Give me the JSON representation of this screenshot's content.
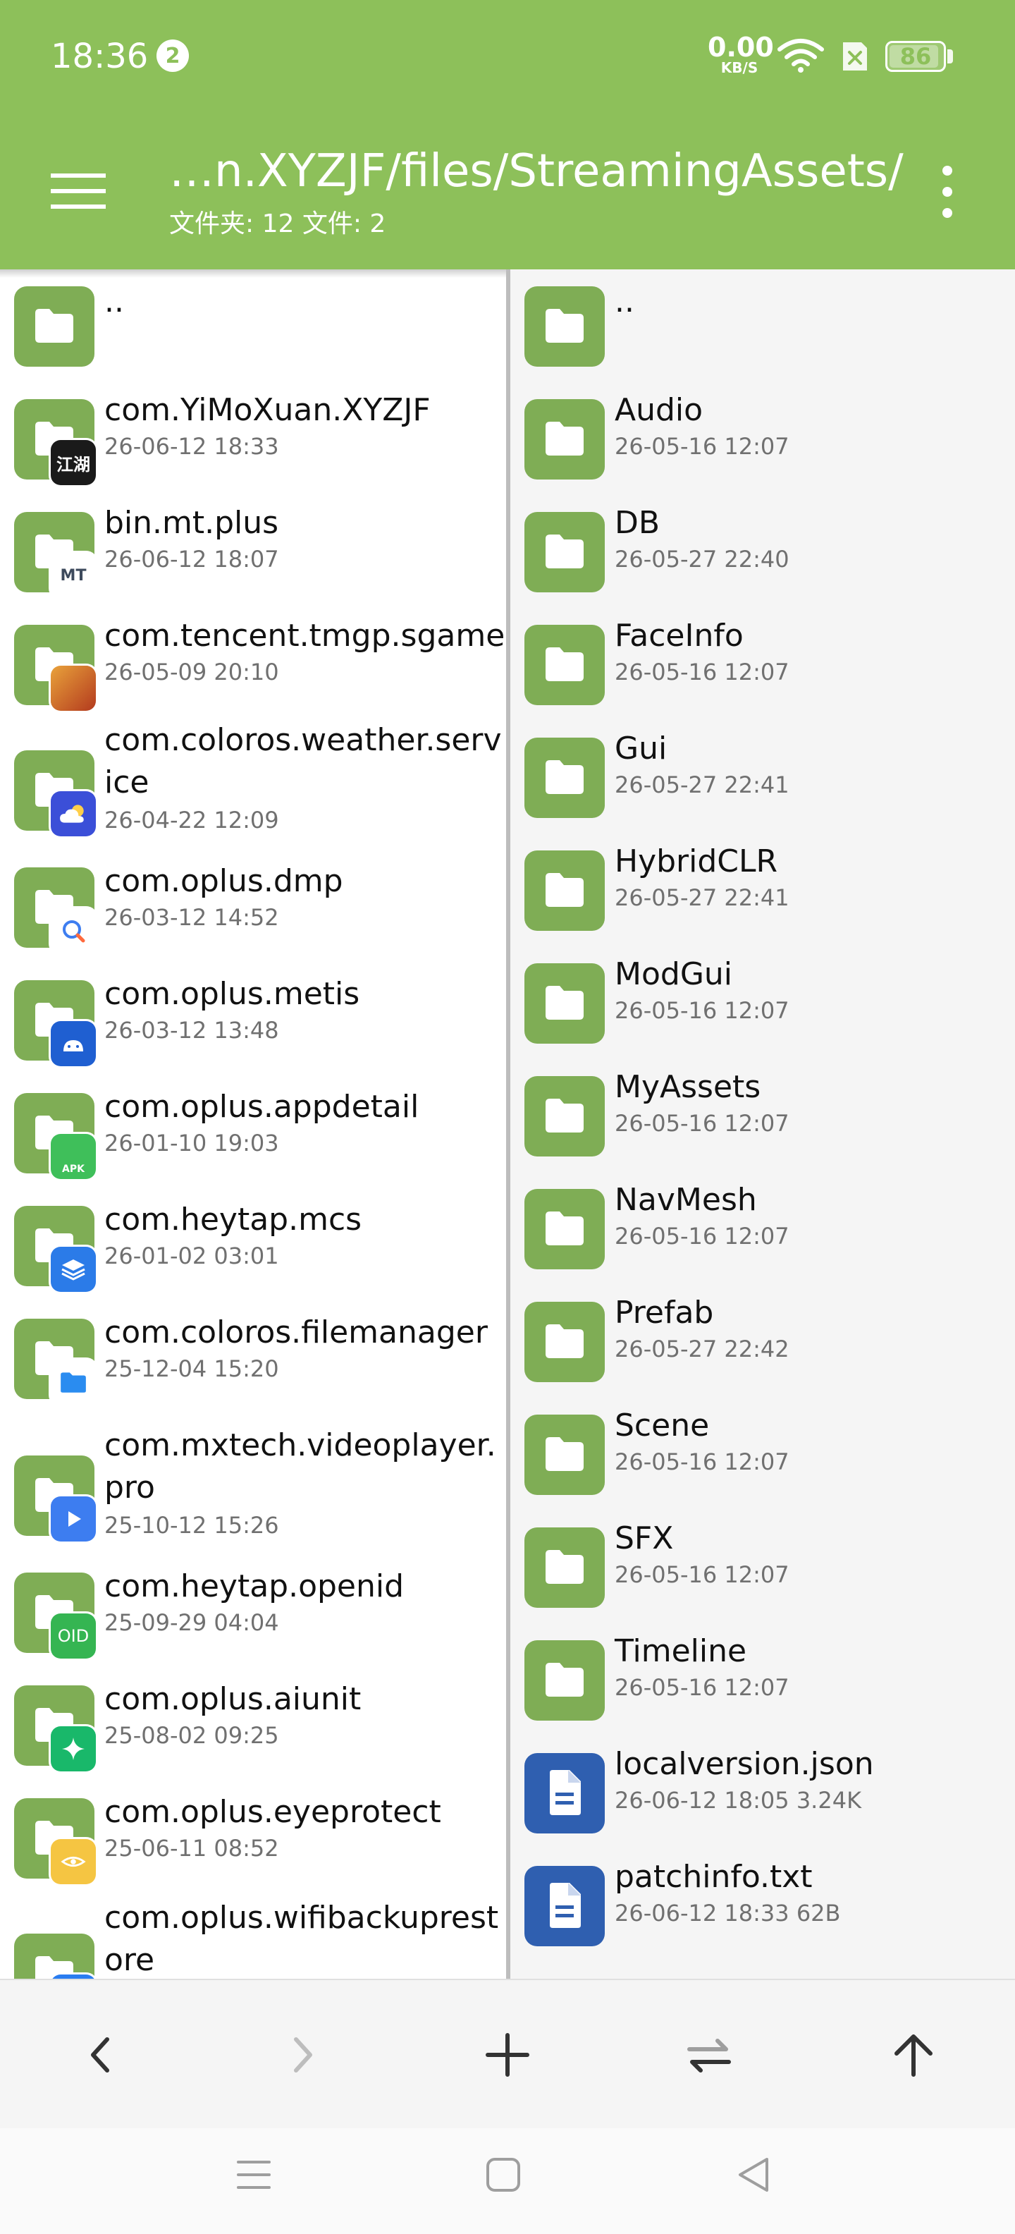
{
  "status_bar": {
    "time": "18:36",
    "notification_count": "2",
    "net_speed_value": "0.00",
    "net_speed_unit": "KB/S",
    "battery": "86",
    "battery_level_pct": 86
  },
  "header": {
    "path_title": "…n.XYZJF/files/StreamingAssets/",
    "folder_count": "文件夹: 12 文件: 2"
  },
  "left_panel": {
    "items": [
      {
        "name": "..",
        "date": ""
      },
      {
        "name": "com.YiMoXuan.XYZJF",
        "date": "26-06-12 18:33",
        "badge_text": "江湖",
        "badge_color": "#1a1a1a"
      },
      {
        "name": "bin.mt.plus",
        "date": "26-06-12 18:07",
        "badge_text": "MT",
        "badge_color": "#3d4a5c"
      },
      {
        "name": "com.tencent.tmgp.sgame",
        "date": "26-05-09 20:10",
        "badge_text": "",
        "badge_color": "#c4452a"
      },
      {
        "name": "com.coloros.weather.serv",
        "name2": "ice",
        "date": "26-04-22 12:09",
        "badge_text": "",
        "badge_color": "#3b4fd8"
      },
      {
        "name": "com.oplus.dmp",
        "date": "26-03-12 14:52",
        "badge_text": "",
        "badge_color": "#ffffff"
      },
      {
        "name": "com.oplus.metis",
        "date": "26-03-12 13:48",
        "badge_text": "",
        "badge_color": "#1f5fd1"
      },
      {
        "name": "com.oplus.appdetail",
        "date": "26-01-10 19:03",
        "badge_text": "APK",
        "badge_color": "#3fbf5a"
      },
      {
        "name": "com.heytap.mcs",
        "date": "26-01-02 03:01",
        "badge_text": "",
        "badge_color": "#2b7be8"
      },
      {
        "name": "com.coloros.filemanager",
        "date": "25-12-04 15:20",
        "badge_text": "",
        "badge_color": "#ffffff"
      },
      {
        "name": "com.mxtech.videoplayer.",
        "name2": "pro",
        "date": "25-10-12 15:26",
        "badge_text": "",
        "badge_color": "#3d7df0"
      },
      {
        "name": "com.heytap.openid",
        "date": "25-09-29 04:04",
        "badge_text": "OID",
        "badge_color": "#35b552"
      },
      {
        "name": "com.oplus.aiunit",
        "date": "25-08-02 09:25",
        "badge_text": "",
        "badge_color": "#19b86a"
      },
      {
        "name": "com.oplus.eyeprotect",
        "date": "25-06-11 08:52",
        "badge_text": "",
        "badge_color": "#f5c542"
      },
      {
        "name": "com.oplus.wifibackuprest",
        "name2": "ore",
        "date": "",
        "badge_text": "",
        "badge_color": "#2a7df0"
      }
    ]
  },
  "right_panel": {
    "items": [
      {
        "name": "..",
        "meta": "",
        "type": "folder"
      },
      {
        "name": "Audio",
        "meta": "26-05-16 12:07",
        "type": "folder"
      },
      {
        "name": "DB",
        "meta": "26-05-27 22:40",
        "type": "folder"
      },
      {
        "name": "FaceInfo",
        "meta": "26-05-16 12:07",
        "type": "folder"
      },
      {
        "name": "Gui",
        "meta": "26-05-27 22:41",
        "type": "folder"
      },
      {
        "name": "HybridCLR",
        "meta": "26-05-27 22:41",
        "type": "folder"
      },
      {
        "name": "ModGui",
        "meta": "26-05-16 12:07",
        "type": "folder"
      },
      {
        "name": "MyAssets",
        "meta": "26-05-16 12:07",
        "type": "folder"
      },
      {
        "name": "NavMesh",
        "meta": "26-05-16 12:07",
        "type": "folder"
      },
      {
        "name": "Prefab",
        "meta": "26-05-27 22:42",
        "type": "folder"
      },
      {
        "name": "Scene",
        "meta": "26-05-16 12:07",
        "type": "folder"
      },
      {
        "name": "SFX",
        "meta": "26-05-16 12:07",
        "type": "folder"
      },
      {
        "name": "Timeline",
        "meta": "26-05-16 12:07",
        "type": "folder"
      },
      {
        "name": "localversion.json",
        "meta": "26-06-12 18:05  3.24K",
        "type": "file"
      },
      {
        "name": "patchinfo.txt",
        "meta": "26-06-12 18:33  62B",
        "type": "file"
      }
    ]
  },
  "toolbar": {
    "icons": [
      "back-icon",
      "forward-icon",
      "add-icon",
      "swap-icon",
      "up-icon"
    ]
  },
  "colors": {
    "accent": "#8dc05a",
    "folder": "#7fad55",
    "file": "#2f5fb0"
  }
}
